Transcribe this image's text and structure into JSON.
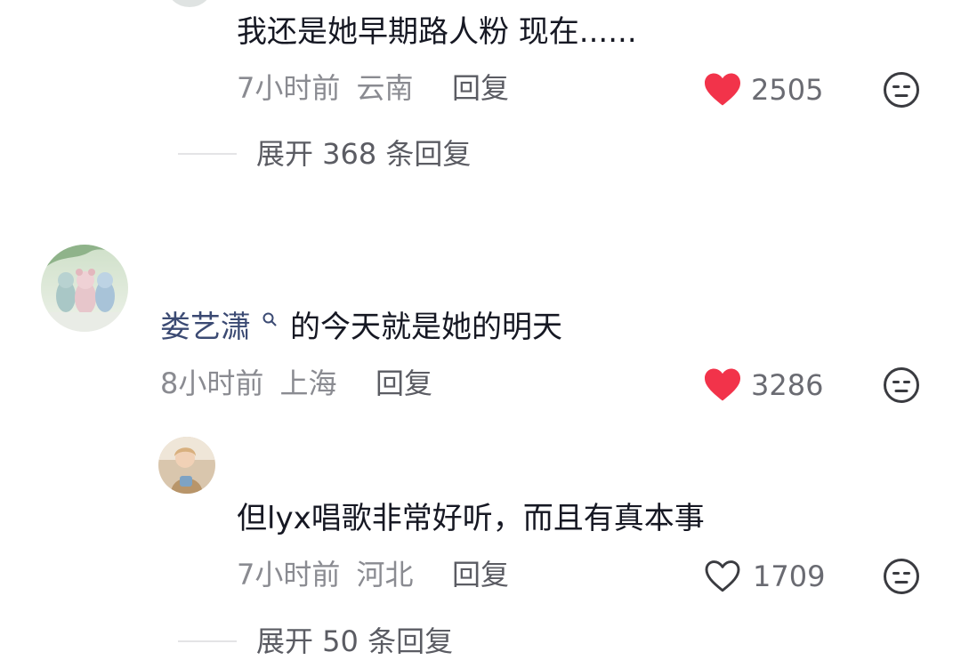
{
  "comments": [
    {
      "text": "我还是她早期路人粉 现在......",
      "time": "7小时前",
      "location": "云南",
      "reply_label": "回复",
      "likes": "2505",
      "liked": true,
      "expand": {
        "label": "展开 368 条回复"
      }
    },
    {
      "username": "娄艺潇",
      "text": "的今天就是她的明天",
      "time": "8小时前",
      "location": "上海",
      "reply_label": "回复",
      "likes": "3286",
      "liked": true
    },
    {
      "text": "但lyx唱歌非常好听，而且有真本事",
      "time": "7小时前",
      "location": "河北",
      "reply_label": "回复",
      "likes": "1709",
      "liked": false,
      "expand": {
        "label": "展开 50 条回复"
      }
    }
  ],
  "colors": {
    "like_active": "#f2334a",
    "username": "#3b4a73",
    "meta": "#8a8b91"
  },
  "icons": {
    "heart_filled": "heart-filled-icon",
    "heart_outline": "heart-outline-icon",
    "dislike": "meh-face-icon",
    "search": "search-icon"
  }
}
